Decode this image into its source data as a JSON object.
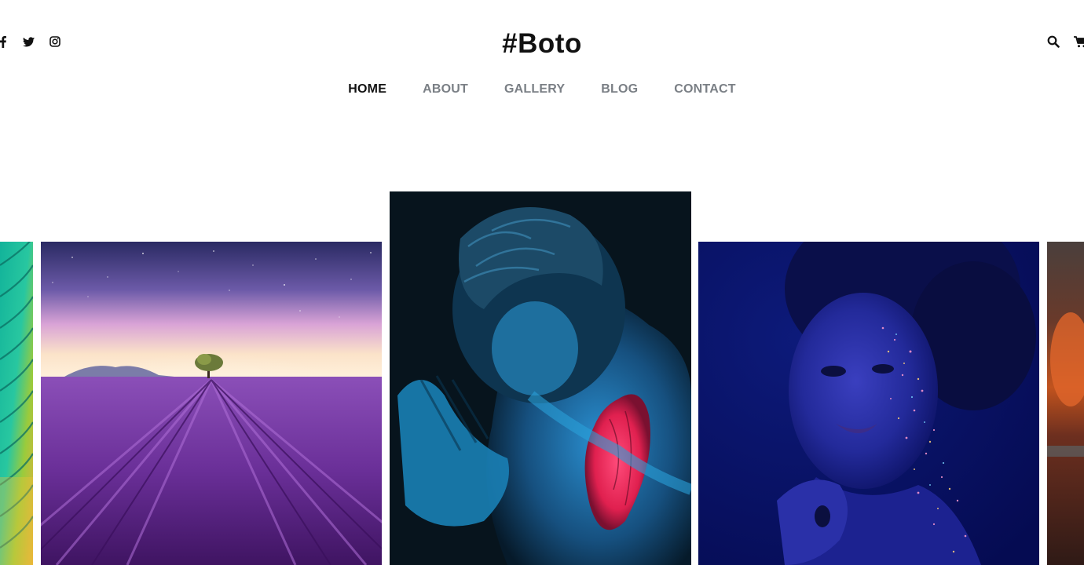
{
  "header": {
    "brand": "#Boto",
    "social_icons": [
      "facebook-icon",
      "twitter-icon",
      "instagram-icon"
    ],
    "utility_icons": [
      "search-icon",
      "cart-icon"
    ]
  },
  "nav": {
    "items": [
      {
        "label": "HOME",
        "active": true
      },
      {
        "label": "ABOUT",
        "active": false
      },
      {
        "label": "GALLERY",
        "active": false
      },
      {
        "label": "BLOG",
        "active": false
      },
      {
        "label": "CONTACT",
        "active": false
      }
    ],
    "active_underline_color": "#7fb24a"
  },
  "gallery": {
    "images": [
      "tropical-leaf-image",
      "lavender-field-image",
      "neon-heart-man-image",
      "glitter-woman-image",
      "warm-interior-image"
    ]
  },
  "colors": {
    "text": "#111111",
    "nav_inactive": "#7a7f85",
    "background": "#ffffff"
  }
}
